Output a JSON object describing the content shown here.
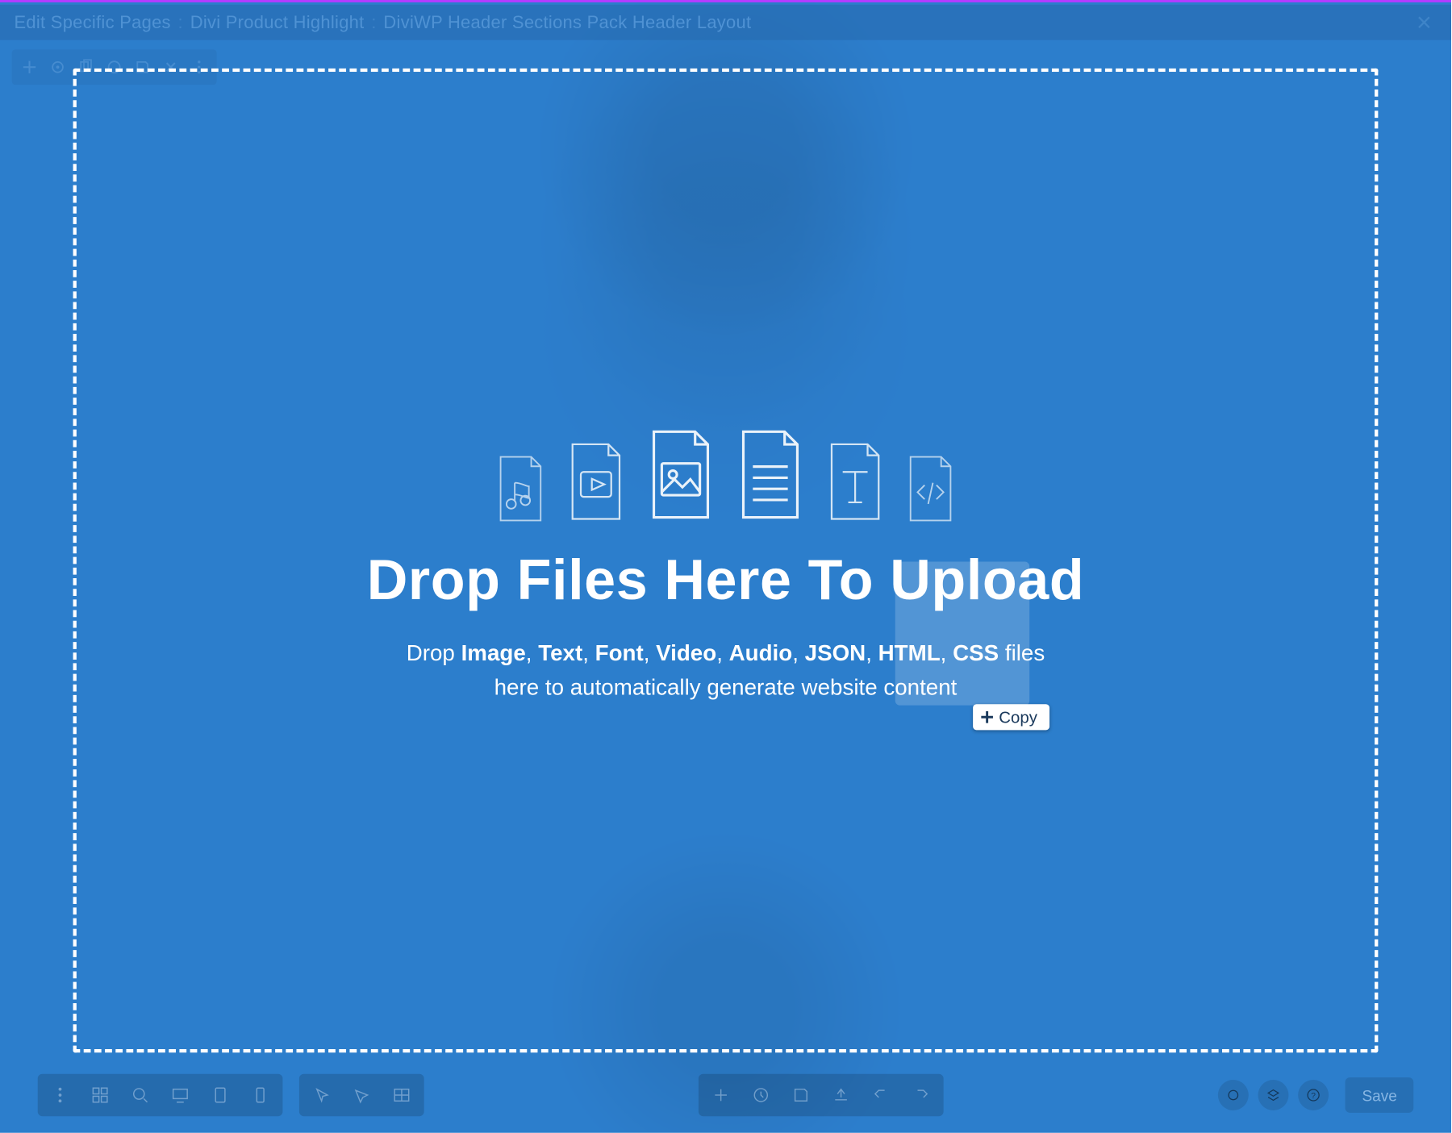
{
  "titlebar": {
    "prefix": "Edit Specific Pages",
    "product": "Divi Product Highlight",
    "page": "DiviWP Header Sections Pack Header Layout"
  },
  "dropzone": {
    "title": "Drop Files Here To Upload",
    "lead": "Drop ",
    "types": [
      "Image",
      "Text",
      "Font",
      "Video",
      "Audio",
      "JSON",
      "HTML",
      "CSS"
    ],
    "tail": " files here to automatically generate website content"
  },
  "drag": {
    "copy_label": "Copy"
  },
  "bottom": {
    "save": "Save"
  }
}
